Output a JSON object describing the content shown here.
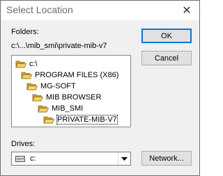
{
  "window": {
    "title": "Select Location",
    "close_glyph": "✕"
  },
  "folders": {
    "label": "Folders:",
    "current_path": "c:\\...\\mib_smi\\private-mib-v7",
    "tree": [
      {
        "label": "c:\\",
        "level": 0,
        "icon": "open-folder-icon"
      },
      {
        "label": "PROGRAM FILES (X86)",
        "level": 1,
        "icon": "open-folder-icon"
      },
      {
        "label": "MG-SOFT",
        "level": 2,
        "icon": "open-folder-icon"
      },
      {
        "label": "MIB BROWSER",
        "level": 3,
        "icon": "open-folder-icon"
      },
      {
        "label": "MIB_SMI",
        "level": 4,
        "icon": "open-folder-icon"
      },
      {
        "label": "PRIVATE-MIB-V7",
        "level": 5,
        "icon": "open-folder-icon",
        "selected": true
      }
    ]
  },
  "drives": {
    "label": "Drives:",
    "value": "c:",
    "icon": "drive-icon"
  },
  "buttons": {
    "ok": "OK",
    "cancel": "Cancel",
    "network": "Network..."
  },
  "colors": {
    "folder": "#f5d36b",
    "folder_dark": "#c9a13b",
    "accent": "#0078d7"
  }
}
